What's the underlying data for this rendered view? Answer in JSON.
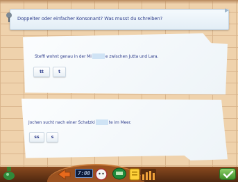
{
  "instruction": {
    "text": "Doppelter oder einfacher Konsonant? Was musst du schreiben?"
  },
  "tasks": [
    {
      "before": "Steffi wohnt genau in der Mi",
      "after": "e zwischen Jutta und Lara.",
      "options": [
        "tt",
        "t"
      ]
    },
    {
      "before": "Jochen sucht nach einer Schatzki",
      "after": "te im Meer.",
      "options": [
        "ss",
        "s"
      ]
    }
  ],
  "toolbar": {
    "clock_text": "7:00"
  },
  "colors": {
    "text": "#2b3a8a",
    "blank": "#cfe3f5",
    "wall": "#efd2ac",
    "bar": "#6b3816",
    "ok": "#5aaa3a"
  }
}
